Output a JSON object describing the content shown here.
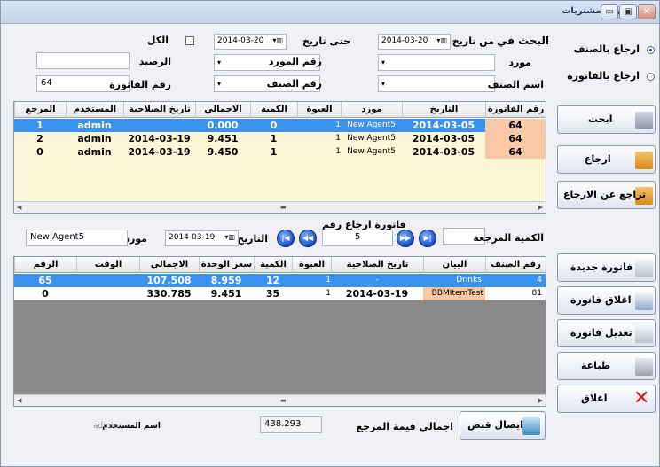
{
  "window": {
    "title": "فاتورة مشتريات",
    "min_label": "▭",
    "max_label": "▣",
    "close_label": "✕"
  },
  "mode": {
    "by_item": "ارجاع بالصنف",
    "by_invoice": "ارجاع بالفاتورة",
    "selected": "by_item"
  },
  "search": {
    "search_in": "البحث في",
    "from_date_label": "من تاريخ",
    "from_date": "2014-03-20",
    "to_date_label": "حتى تاريخ",
    "to_date": "2014-03-20",
    "all_label": "الكل",
    "supplier_label": "مورد",
    "supplier_no_label": "رقم المورد",
    "balance_label": "الرصيد",
    "item_name_label": "اسم الصنف",
    "item_no_label": "رقم الصنف",
    "invoice_no_label": "رقم الفاتورة",
    "invoice_no": "64"
  },
  "grid1": {
    "headers": [
      "رقم الفاتورة",
      "التاريخ",
      "مورد",
      "العبوة",
      "الكمية",
      "الاجمالي",
      "تاريخ الصلاحية",
      "المستخدم",
      "المرجع"
    ],
    "rows": [
      [
        "64",
        "2014-03-05",
        "New Agent5",
        "1",
        "0",
        "0.000",
        "",
        "admin",
        "1"
      ],
      [
        "64",
        "2014-03-05",
        "New Agent5",
        "1",
        "1",
        "9.451",
        "2014-03-19",
        "admin",
        "2"
      ],
      [
        "64",
        "2014-03-05",
        "New Agent5",
        "1",
        "1",
        "9.450",
        "2014-03-19",
        "admin",
        "0"
      ]
    ]
  },
  "buttons": {
    "search": "ابحث",
    "return": "ارجاع",
    "undo_return": "تراجع عن الارجاع",
    "new_invoice": "فاتورة جديدة",
    "close_invoice": "اغلاق فاتورة",
    "edit_invoice": "تعديل فاتورة",
    "print": "طباعة",
    "close": "اغلاق",
    "receipt": "ايصال قبض"
  },
  "nav": {
    "caption": "فاتورة ارجاع رقم",
    "number": "5",
    "date_label": "التاريخ",
    "date": "2014-03-19",
    "supplier_label": "مورد",
    "supplier": "New Agent5",
    "ref_qty_label": "الكمية المرجعة",
    "ref_qty": ""
  },
  "grid2": {
    "headers": [
      "رقم الصنف",
      "البيان",
      "تاريخ الصلاحية",
      "العبوة",
      "الكمية",
      "سعر الوحدة",
      "الاجمالي",
      "الوقت",
      "الرقم"
    ],
    "rows": [
      [
        "4",
        "Drinks",
        "-",
        "1",
        "12",
        "8.959",
        "107.508",
        "",
        "65"
      ],
      [
        "81",
        "BBMItemTest",
        "2014-03-19",
        "1",
        "35",
        "9.451",
        "330.785",
        "",
        "0"
      ]
    ]
  },
  "footer": {
    "total_label": "اجمالي قيمة المرجع",
    "total": "438.293",
    "user_label": "اسم المستخدم",
    "user": "admin"
  },
  "colors": {
    "selected_row": "#3a92ee",
    "highlight_cell": "#f8c8a6",
    "row_bg": "#fbf7d6"
  }
}
